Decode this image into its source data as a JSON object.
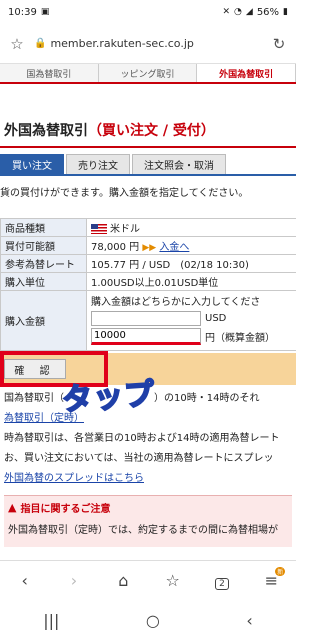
{
  "status_bar": {
    "time": "10:39",
    "battery": "56%"
  },
  "url_bar": {
    "url": "member.rakuten-sec.co.jp"
  },
  "site_tabs": [
    "国為替取引",
    "ッピング取引",
    "外国為替取引"
  ],
  "page": {
    "title_prefix": "外国為替取引",
    "title_suffix": "（買い注文 / 受付）",
    "tabs": [
      "買い注文",
      "売り注文",
      "注文照会・取消"
    ],
    "description": "貨の買付けができます。購入金額を指定してください。"
  },
  "order_table": {
    "currency_label": "商品種類",
    "currency_value": "米ドル",
    "buying_power_label": "買付可能額",
    "buying_power_value": "78,000 円",
    "deposit_link": "入金へ",
    "rate_label": "参考為替レート",
    "rate_value": "105.77 円 / USD　(02/18 10:30)",
    "unit_label": "購入単位",
    "unit_value": "1.00USD以上0.01USD単位",
    "amount_label": "購入金額",
    "amount_note": "購入金額はどちらかに入力してくださ",
    "usd_unit": "USD",
    "jpy_value": "10000",
    "jpy_unit": "円（概算金額）"
  },
  "confirm": {
    "button_label": "確 認",
    "tap_label": "タップ"
  },
  "notes": {
    "line1": "国為替取引（　　　　　　　　　）の10時・14時のそれ",
    "link1": "為替取引（定時）",
    "line2": "時為替取引は、各営業日の10時および14時の適用為替レート",
    "line3": "お、買い注文においては、当社の適用為替レートにスプレッ",
    "link2": "外国為替のスプレッドはこちら"
  },
  "caution": {
    "title": "指目に関するご注意",
    "body": "外国為替取引（定時）では、約定するまでの間に為替相場が"
  },
  "browser_nav": {
    "tabs_count": "2",
    "badge": "新"
  }
}
